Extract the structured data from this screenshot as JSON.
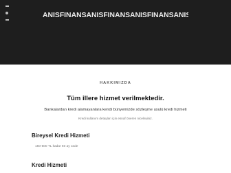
{
  "header": {
    "brand": "ANISFINANSANISFINANSANISFINANSANISFINANS",
    "menu_icon": "menu-icon"
  },
  "about": {
    "section_label": "HAKKIMIZDA",
    "headline": "Tüm illere hizmet verilmektedir.",
    "lead": "Bankalardan kredi alamayanlara kendi bünyemizde sözleşme usulü kredi hizmeti",
    "sub": "Kredi kullanım detayları için esnaf öneren niceleyiniz."
  },
  "services": [
    {
      "title": "Bireysel Kredi Hizmeti",
      "desc": "150-500 TL kadar 60 ay vade"
    },
    {
      "title": "Kredi Hizmeti"
    }
  ]
}
